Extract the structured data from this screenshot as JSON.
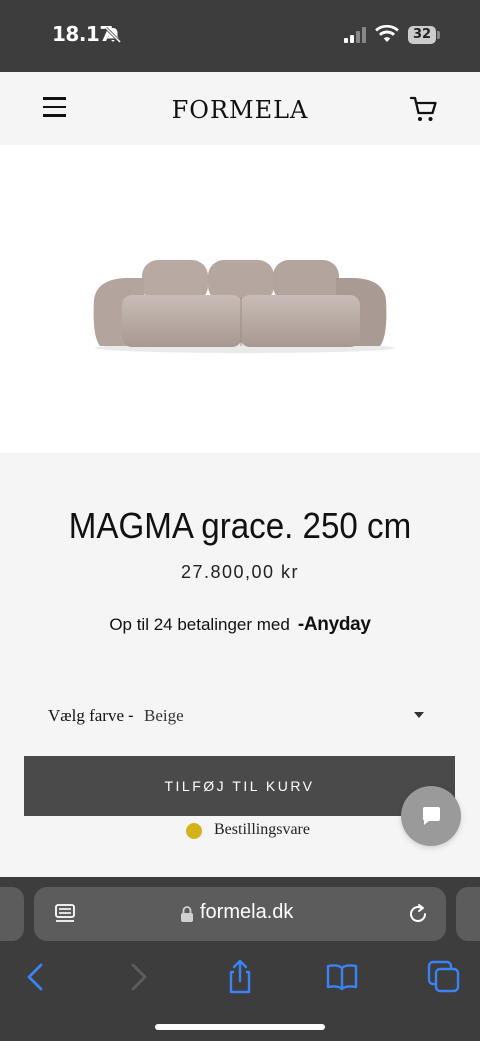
{
  "status_bar": {
    "time": "18.17",
    "battery": "32",
    "icons": [
      "bell-slash-icon",
      "signal-icon",
      "wifi-icon",
      "battery-icon"
    ]
  },
  "header": {
    "logo": "FORMELA",
    "icons": [
      "menu-icon",
      "cart-icon"
    ]
  },
  "product": {
    "image_icon": "sofa-image",
    "title": "MAGMA grace. 250 cm",
    "price": "27.800,00 kr",
    "installments_text": "Op til 24 betalinger med",
    "installments_brand": "-Anyday",
    "color_label": "Vælg farve",
    "color_separator": "-",
    "color_value": "Beige",
    "add_to_cart": "TILFØJ TIL KURV",
    "stock_status": "Bestillingsvare",
    "stock_color": "#d4b21d"
  },
  "chat": {
    "icon": "chat-bubble-icon"
  },
  "browser": {
    "url": "formela.dk",
    "icons": [
      "reader-icon",
      "lock-icon",
      "reload-icon",
      "back-icon",
      "forward-icon",
      "share-icon",
      "bookmarks-icon",
      "tabs-icon"
    ],
    "accent": "#3b82f6"
  },
  "colors": {
    "chrome_dark": "#3d3d3d",
    "button_dark": "#4a4a4a",
    "page_bg": "#f5f5f5"
  }
}
